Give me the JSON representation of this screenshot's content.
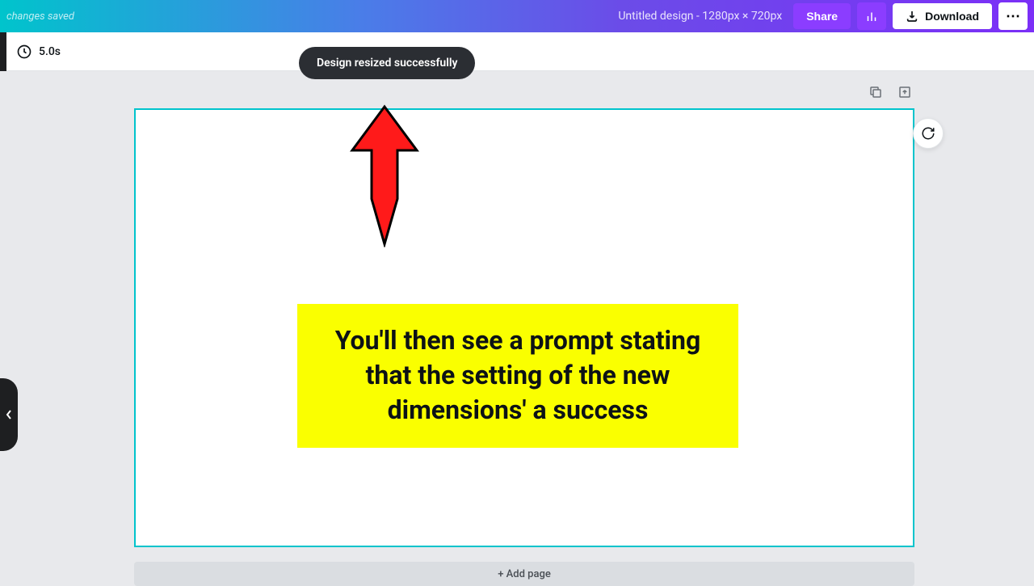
{
  "header": {
    "status_text": "changes saved",
    "doc_title": "Untitled design - 1280px × 720px",
    "share_label": "Share",
    "download_label": "Download"
  },
  "subbar": {
    "duration": "5.0s"
  },
  "toast": {
    "message": "Design resized successfully"
  },
  "canvas": {
    "add_page_label": "+ Add page",
    "callout_text": "You'll then see a prompt stating that the setting of the new dimensions' a success"
  },
  "colors": {
    "accent_teal": "#00c4cc",
    "accent_purple": "#8b3dff",
    "callout_bg": "#faff00",
    "arrow_fill": "#ff0000"
  }
}
